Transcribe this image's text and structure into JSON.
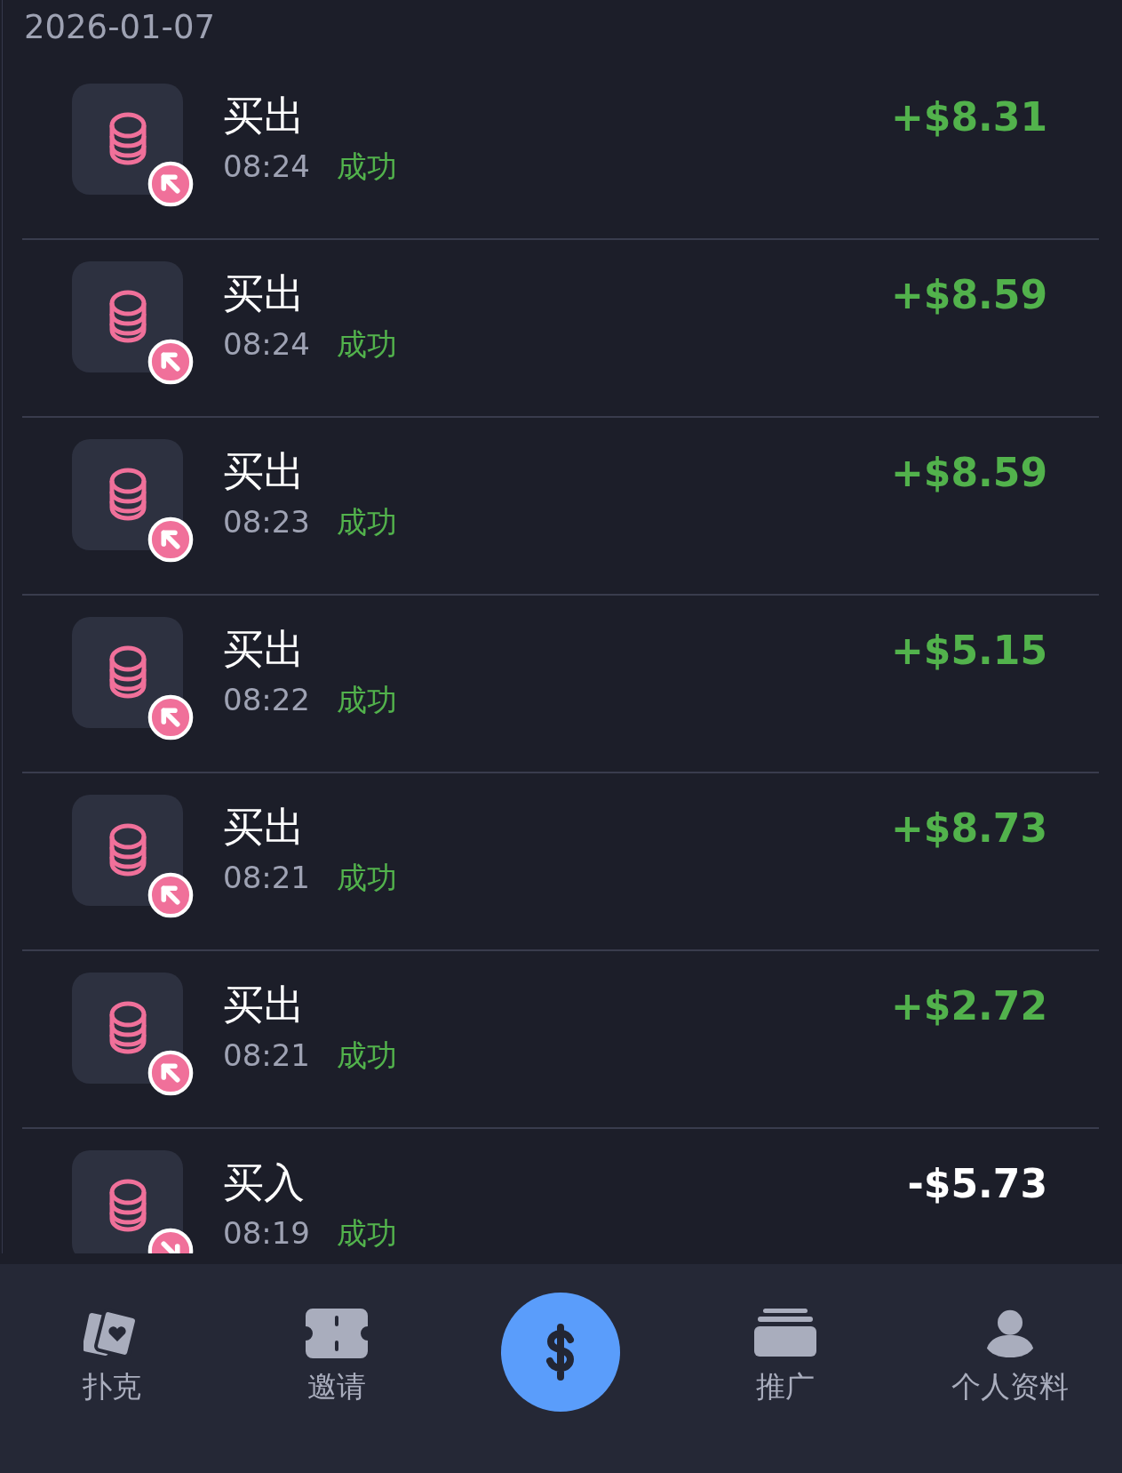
{
  "date": "2026-01-07",
  "transactions": [
    {
      "title": "买出",
      "time": "08:24",
      "status": "成功",
      "amount": "+$8.31",
      "kind": "sell"
    },
    {
      "title": "买出",
      "time": "08:24",
      "status": "成功",
      "amount": "+$8.59",
      "kind": "sell"
    },
    {
      "title": "买出",
      "time": "08:23",
      "status": "成功",
      "amount": "+$8.59",
      "kind": "sell"
    },
    {
      "title": "买出",
      "time": "08:22",
      "status": "成功",
      "amount": "+$5.15",
      "kind": "sell"
    },
    {
      "title": "买出",
      "time": "08:21",
      "status": "成功",
      "amount": "+$8.73",
      "kind": "sell"
    },
    {
      "title": "买出",
      "time": "08:21",
      "status": "成功",
      "amount": "+$2.72",
      "kind": "sell"
    },
    {
      "title": "买入",
      "time": "08:19",
      "status": "成功",
      "amount": "-$5.73",
      "kind": "buy"
    }
  ],
  "nav": [
    {
      "kind": "cards",
      "label": "扑克"
    },
    {
      "kind": "ticket",
      "label": "邀请"
    },
    {
      "kind": "dollar"
    },
    {
      "kind": "stack",
      "label": "推广"
    },
    {
      "kind": "person",
      "label": "个人资料"
    }
  ]
}
